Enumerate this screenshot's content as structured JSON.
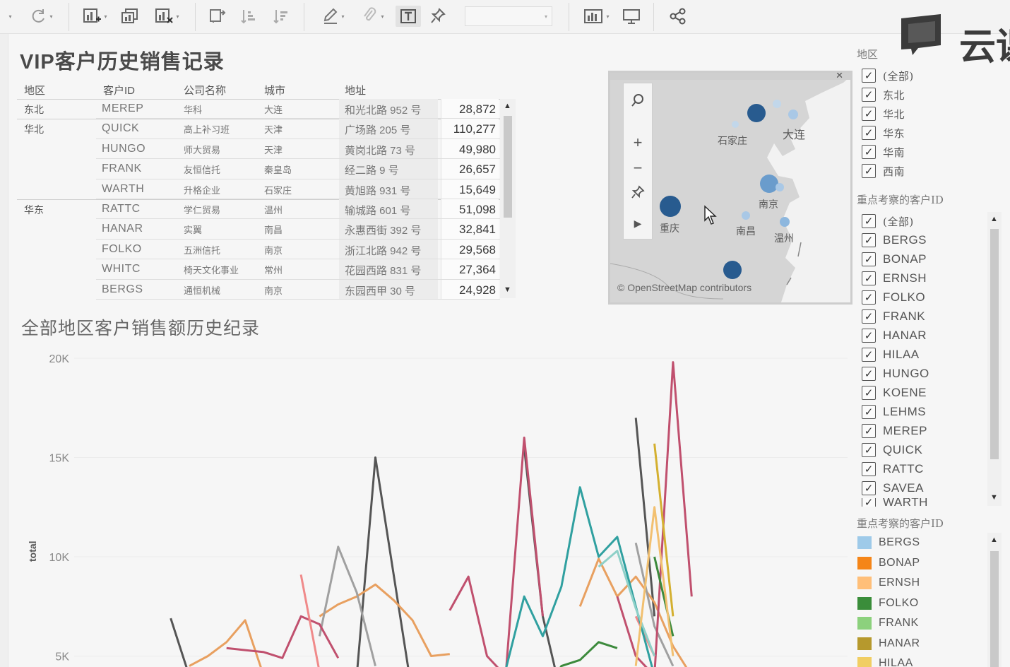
{
  "toolbar": {
    "icons": [
      "dropdown-caret-icon",
      "refresh-icon",
      "new-worksheet-icon",
      "duplicate-sheet-icon",
      "clear-sheet-icon",
      "swap-axes-icon",
      "sort-ascending-icon",
      "sort-descending-icon",
      "highlight-icon",
      "group-icon",
      "show-labels-icon",
      "pin-icon",
      "show-me-icon",
      "presentation-icon",
      "share-icon"
    ],
    "fit_select": ""
  },
  "logo": {
    "text": "云课"
  },
  "vip_table": {
    "title": "VIP客户历史销售记录",
    "headers": [
      "地区",
      "客户ID",
      "公司名称",
      "城市",
      "地址"
    ],
    "rows": [
      {
        "region": "东北",
        "id": "MEREP",
        "company": "华科",
        "city": "大连",
        "address": "和光北路 952 号",
        "value": "28,872"
      },
      {
        "region": "华北",
        "id": "QUICK",
        "company": "高上补习班",
        "city": "天津",
        "address": "广场路 205 号",
        "value": "110,277"
      },
      {
        "region": "",
        "id": "HUNGO",
        "company": "师大贸易",
        "city": "天津",
        "address": "黄岗北路 73 号",
        "value": "49,980"
      },
      {
        "region": "",
        "id": "FRANK",
        "company": "友恒信托",
        "city": "秦皇岛",
        "address": "经二路 9 号",
        "value": "26,657"
      },
      {
        "region": "",
        "id": "WARTH",
        "company": "升格企业",
        "city": "石家庄",
        "address": "黄旭路 931 号",
        "value": "15,649"
      },
      {
        "region": "华东",
        "id": "RATTC",
        "company": "学仁贸易",
        "city": "温州",
        "address": "输城路 601 号",
        "value": "51,098"
      },
      {
        "region": "",
        "id": "HANAR",
        "company": "实翼",
        "city": "南昌",
        "address": "永惠西街 392 号",
        "value": "32,841"
      },
      {
        "region": "",
        "id": "FOLKO",
        "company": "五洲信托",
        "city": "南京",
        "address": "浙江北路 942 号",
        "value": "29,568"
      },
      {
        "region": "",
        "id": "WHITC",
        "company": "椅天文化事业",
        "city": "常州",
        "address": "花园西路 831 号",
        "value": "27,364"
      },
      {
        "region": "",
        "id": "BERGS",
        "company": "通恒机械",
        "city": "南京",
        "address": "东园西甲 30 号",
        "value": "24,928"
      }
    ]
  },
  "map": {
    "credit": "© OpenStreetMap contributors",
    "cities": [
      "石家庄",
      "大连",
      "南京",
      "重庆",
      "南昌",
      "温州"
    ],
    "tools": [
      "search-icon",
      "zoom-in-icon",
      "zoom-out-icon",
      "pin-icon",
      "play-icon"
    ]
  },
  "chart": {
    "title": "全部地区客户销售额历史纪录",
    "ylabel": "total",
    "yticks": [
      "20K",
      "15K",
      "10K",
      "5K"
    ]
  },
  "chart_data": {
    "type": "line",
    "title": "全部地区客户销售额历史纪录",
    "ylabel": "total",
    "ylim": [
      4000,
      21000
    ],
    "x": [
      1,
      2,
      3,
      4,
      5,
      6,
      7,
      8,
      9,
      10,
      11,
      12,
      13,
      14,
      15,
      16,
      17,
      18,
      19,
      20,
      21,
      22,
      23,
      24,
      25,
      26,
      27,
      28,
      29,
      30,
      31,
      32,
      33,
      34,
      35,
      36,
      37,
      38,
      39,
      40,
      41,
      42
    ],
    "series": [
      {
        "color": "#555555",
        "values": [
          null,
          null,
          null,
          null,
          null,
          6900,
          4000,
          null,
          null,
          null,
          null,
          null,
          null,
          null,
          null,
          4000,
          15000,
          9000,
          3000,
          null,
          null,
          null,
          null,
          null,
          15500,
          7000,
          3000,
          null,
          null,
          null,
          17000,
          7000,
          null,
          null,
          null,
          null,
          null,
          null,
          null,
          null,
          null,
          null
        ]
      },
      {
        "color": "#e8a060",
        "values": [
          null,
          null,
          null,
          null,
          null,
          null,
          4500,
          5000,
          5700,
          6800,
          4000,
          null,
          null,
          7000,
          7600,
          8000,
          8600,
          7800,
          6800,
          5000,
          5100,
          null,
          null,
          null,
          null,
          null,
          null,
          7500,
          9900,
          8000,
          9000,
          7700,
          5500,
          4000,
          null,
          null,
          null,
          null,
          null,
          null,
          null,
          null
        ]
      },
      {
        "color": "#a0a0a0",
        "values": [
          null,
          null,
          null,
          null,
          null,
          null,
          null,
          null,
          4300,
          null,
          null,
          null,
          null,
          6000,
          10500,
          8200,
          4500,
          null,
          null,
          null,
          null,
          null,
          null,
          null,
          null,
          null,
          null,
          null,
          null,
          null,
          10700,
          6500,
          4500,
          null,
          null,
          null,
          null,
          null,
          null,
          null,
          null,
          null
        ]
      },
      {
        "color": "#c0506e",
        "values": [
          null,
          null,
          null,
          null,
          null,
          null,
          null,
          null,
          5400,
          5300,
          5200,
          4900,
          7000,
          6600,
          4900,
          null,
          null,
          null,
          null,
          null,
          7300,
          9000,
          5000,
          4000,
          16000,
          7000,
          null,
          null,
          null,
          8000,
          5000,
          4000,
          19800,
          8000,
          null,
          null,
          null,
          null,
          null,
          null,
          null,
          null
        ]
      },
      {
        "color": "#f08a8a",
        "values": [
          null,
          null,
          null,
          null,
          null,
          null,
          null,
          null,
          null,
          null,
          null,
          null,
          9100,
          4200,
          null,
          null,
          null,
          null,
          null,
          null,
          null,
          null,
          null,
          null,
          null,
          null,
          null,
          null,
          null,
          null,
          7000,
          5000,
          null,
          null,
          null,
          null,
          null,
          null,
          null,
          null,
          null,
          null
        ]
      },
      {
        "color": "#30a0a0",
        "values": [
          null,
          null,
          null,
          null,
          null,
          null,
          null,
          null,
          null,
          null,
          null,
          null,
          null,
          null,
          null,
          null,
          null,
          null,
          null,
          null,
          null,
          null,
          null,
          4300,
          8000,
          6000,
          8500,
          13500,
          10000,
          11000,
          7500,
          4000,
          null,
          null,
          null,
          null,
          null,
          null,
          null,
          null,
          null,
          null
        ]
      },
      {
        "color": "#8ed0c8",
        "values": [
          null,
          null,
          null,
          null,
          null,
          null,
          null,
          null,
          null,
          null,
          null,
          null,
          null,
          null,
          null,
          null,
          null,
          null,
          null,
          null,
          null,
          null,
          null,
          null,
          null,
          null,
          null,
          null,
          9500,
          10300,
          7400,
          5000,
          null,
          null,
          null,
          null,
          null,
          null,
          null,
          null,
          null,
          null
        ]
      },
      {
        "color": "#3c8a3c",
        "values": [
          null,
          null,
          null,
          null,
          null,
          null,
          null,
          null,
          null,
          null,
          null,
          null,
          null,
          null,
          null,
          null,
          null,
          null,
          null,
          null,
          null,
          null,
          null,
          null,
          null,
          3000,
          4500,
          4800,
          5700,
          5400,
          null,
          10000,
          6000,
          null,
          null,
          null,
          null,
          null,
          null,
          null,
          null,
          null
        ]
      },
      {
        "color": "#d4b030",
        "values": [
          null,
          null,
          null,
          null,
          null,
          null,
          null,
          null,
          null,
          null,
          null,
          null,
          null,
          null,
          null,
          null,
          null,
          null,
          null,
          null,
          null,
          null,
          null,
          null,
          null,
          null,
          null,
          null,
          null,
          null,
          null,
          15700,
          7000,
          null,
          null,
          null,
          null,
          null,
          null,
          null,
          null,
          null
        ]
      },
      {
        "color": "#f2c070",
        "values": [
          null,
          null,
          null,
          null,
          null,
          null,
          null,
          null,
          null,
          null,
          null,
          null,
          null,
          null,
          null,
          null,
          null,
          null,
          null,
          null,
          null,
          null,
          null,
          null,
          null,
          null,
          null,
          null,
          null,
          null,
          4500,
          12500,
          5000,
          null,
          null,
          null,
          null,
          null,
          null,
          null,
          null,
          null
        ]
      }
    ]
  },
  "filters": {
    "region_title": "地区",
    "regions": [
      "(全部)",
      "东北",
      "华北",
      "华东",
      "华南",
      "西南"
    ],
    "customer_title": "重点考察的客户ID",
    "customers": [
      "(全部)",
      "BERGS",
      "BONAP",
      "ERNSH",
      "FOLKO",
      "FRANK",
      "HANAR",
      "HILAA",
      "HUNGO",
      "KOENE",
      "LEHMS",
      "MEREP",
      "QUICK",
      "RATTC",
      "SAVEA",
      "WARTH"
    ],
    "legend_title": "重点考察的客户ID",
    "legend": [
      {
        "label": "BERGS",
        "color": "#9ecae9"
      },
      {
        "label": "BONAP",
        "color": "#f58518"
      },
      {
        "label": "ERNSH",
        "color": "#ffbf79"
      },
      {
        "label": "FOLKO",
        "color": "#3a8d3a"
      },
      {
        "label": "FRANK",
        "color": "#8cd17d"
      },
      {
        "label": "HANAR",
        "color": "#b6992d"
      },
      {
        "label": "HILAA",
        "color": "#f1ce63"
      }
    ]
  }
}
